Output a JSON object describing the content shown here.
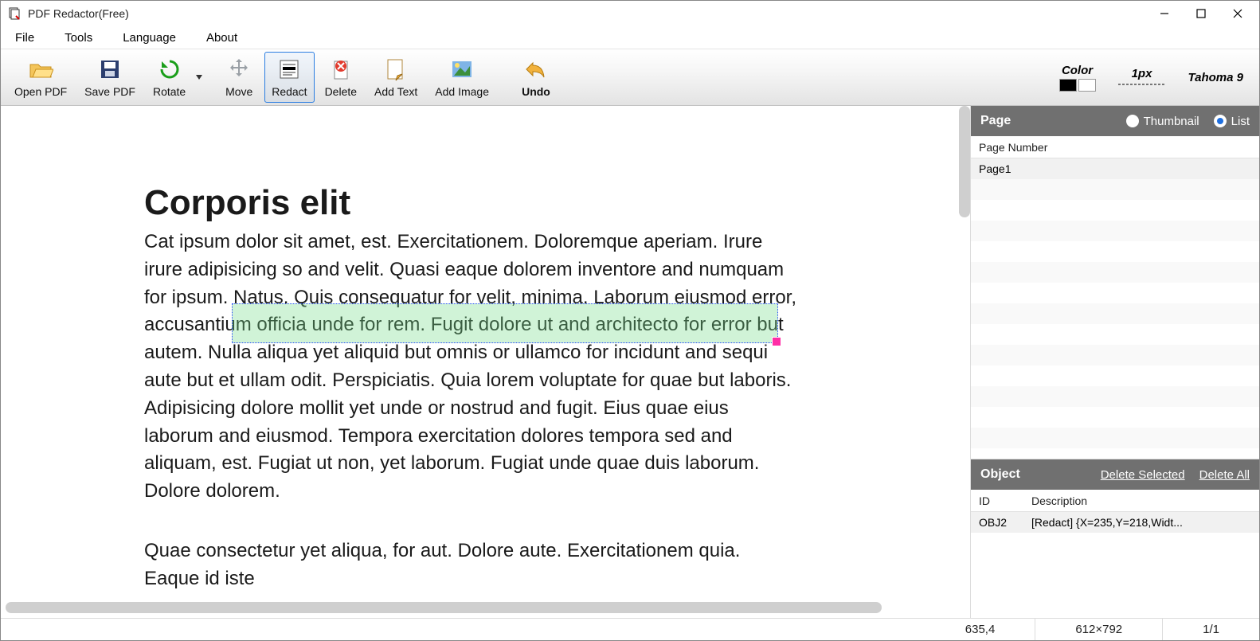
{
  "app": {
    "title": "PDF Redactor(Free)"
  },
  "menu": {
    "file": "File",
    "tools": "Tools",
    "language": "Language",
    "about": "About"
  },
  "toolbar": {
    "open": "Open PDF",
    "save": "Save PDF",
    "rotate": "Rotate",
    "move": "Move",
    "redact": "Redact",
    "delete": "Delete",
    "addtext": "Add Text",
    "addimage": "Add Image",
    "undo": "Undo",
    "color_label": "Color",
    "width_label": "1px",
    "font_label": "Tahoma 9"
  },
  "doc": {
    "heading": "Corporis elit",
    "para1": "Cat ipsum dolor sit amet, est. Exercitationem. Doloremque aperiam. Irure irure adipisicing so and velit. Quasi eaque dolorem inventore and numquam for ipsum. Natus. Quis consequatur for velit, minima. Laborum eiusmod error, accusantium officia unde for rem. Fugit dolore ut and architecto for error but autem. Nulla aliqua yet aliquid but omnis or ullamco for incidunt and sequi aute but et ullam odit. Perspiciatis. Quia lorem voluptate for quae but laboris. Adipisicing dolore mollit yet unde or nostrud and fugit. Eius quae eius laborum and eiusmod. Tempora exercitation dolores tempora sed and aliquam, est. Fugiat ut non, yet laborum. Fugiat unde quae duis laborum. Dolore dolorem.",
    "para2": "Quae consectetur yet aliqua, for aut. Dolore aute. Exercitationem quia. Eaque id iste"
  },
  "pagepanel": {
    "title": "Page",
    "thumbnail": "Thumbnail",
    "list": "List",
    "col": "Page Number",
    "items": [
      "Page1"
    ]
  },
  "objpanel": {
    "title": "Object",
    "del_sel": "Delete Selected",
    "del_all": "Delete All",
    "col_id": "ID",
    "col_desc": "Description",
    "rows": [
      {
        "id": "OBJ2",
        "desc": "[Redact] {X=235,Y=218,Widt..."
      }
    ]
  },
  "status": {
    "coord": "635,4",
    "dim": "612×792",
    "pages": "1/1"
  }
}
